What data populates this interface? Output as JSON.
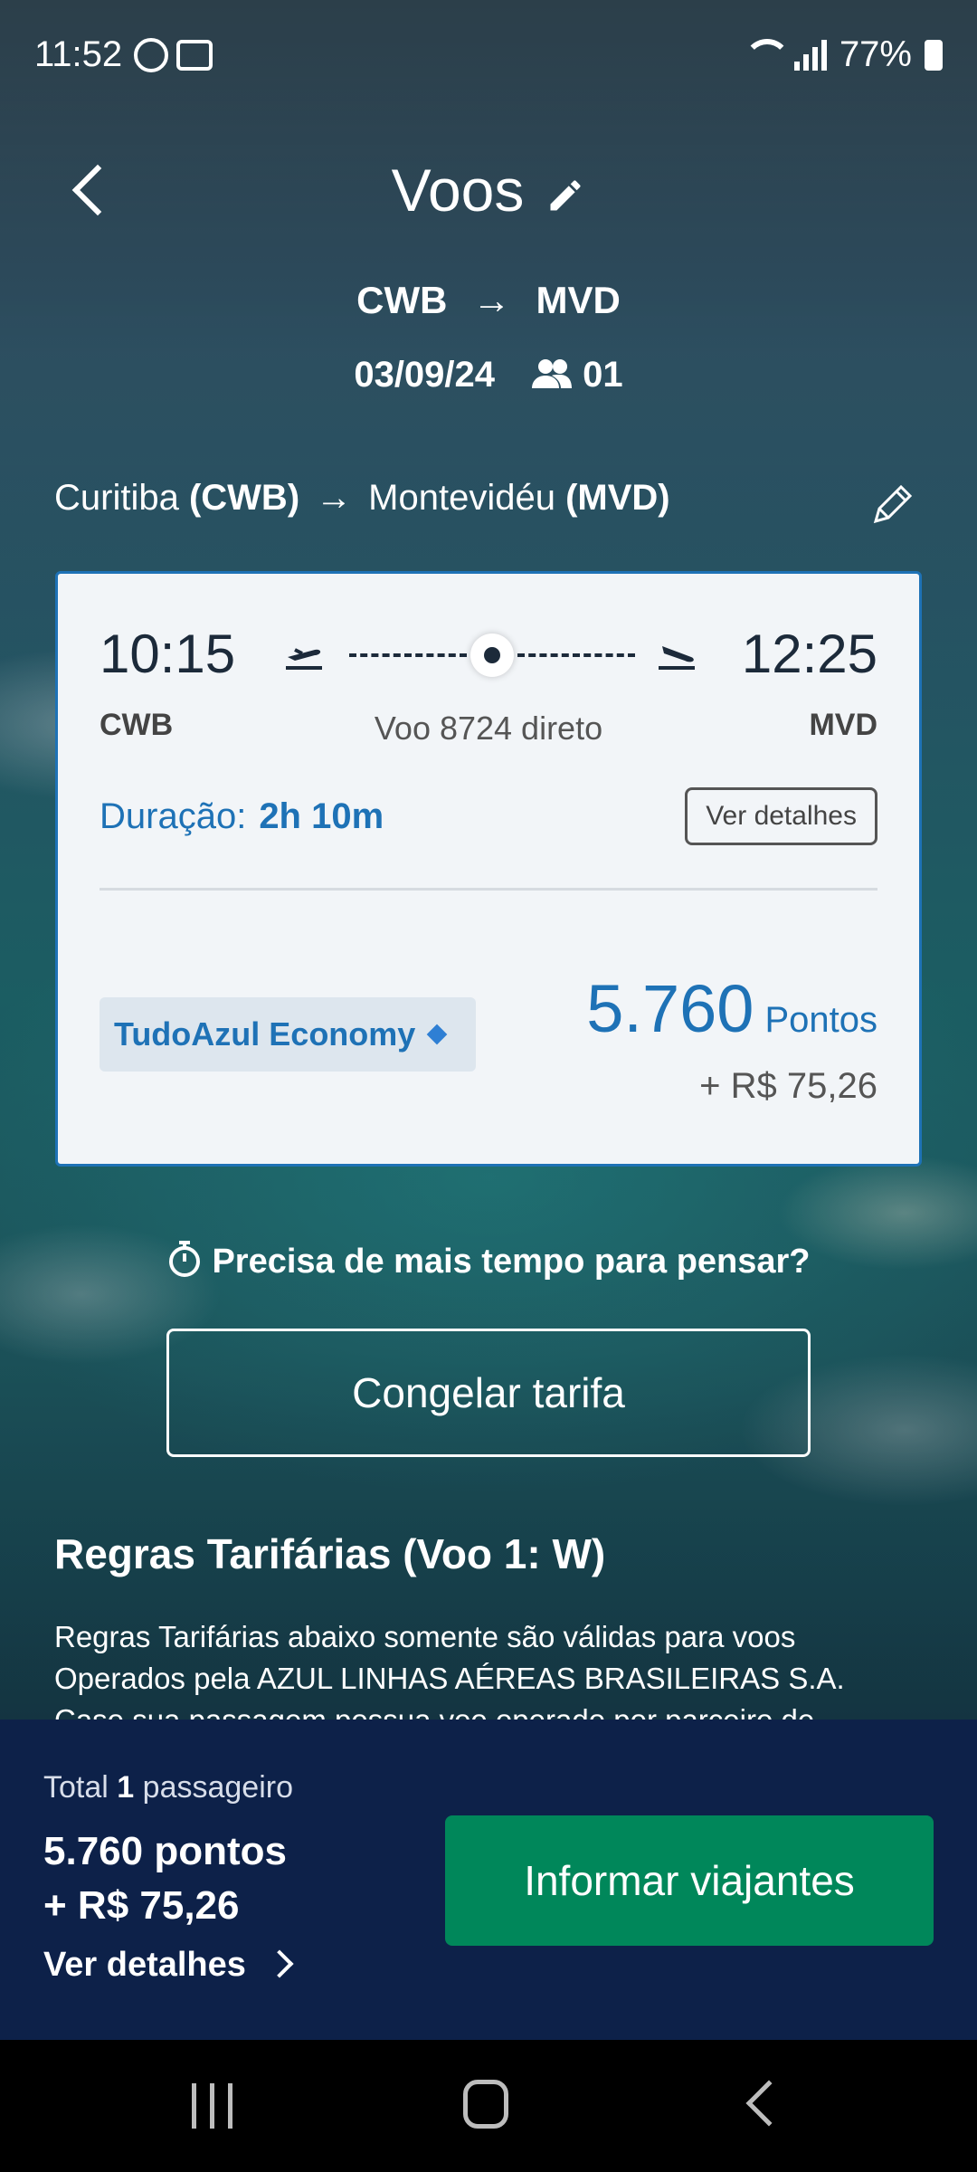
{
  "status_bar": {
    "time": "11:52",
    "battery": "77%"
  },
  "header": {
    "title": "Voos",
    "origin_code": "CWB",
    "destination_code": "MVD",
    "arrow": "→",
    "date": "03/09/24",
    "passengers": "01"
  },
  "route": {
    "origin_city": "Curitiba",
    "origin_code": "(CWB)",
    "arrow": "→",
    "destination_city": "Montevidéu",
    "destination_code": "(MVD)"
  },
  "flight_card": {
    "departure_time": "10:15",
    "arrival_time": "12:25",
    "departure_code": "CWB",
    "arrival_code": "MVD",
    "flight_info": "Voo 8724 direto",
    "duration_label": "Duração:",
    "duration_value": "2h 10m",
    "details_button": "Ver detalhes",
    "fare_family": "TudoAzul Economy",
    "points_value": "5.760",
    "points_label": "Pontos",
    "money": "+ R$ 75,26"
  },
  "freeze": {
    "question": "Precisa de mais tempo para pensar?",
    "button": "Congelar tarifa"
  },
  "rules": {
    "title": "Regras Tarifárias (Voo 1: W)",
    "line1": "Regras Tarifárias abaixo somente são válidas para voos",
    "line2": "Operados pela AZUL LINHAS AÉREAS BRASILEIRAS S.A.",
    "line3": "Caso sua passagem possua voo operado por parceiro de"
  },
  "bottom_bar": {
    "total_prefix": "Total",
    "total_count": "1",
    "total_suffix": "passageiro",
    "points": "5.760 pontos",
    "money": "+ R$ 75,26",
    "details_link": "Ver detalhes",
    "cta": "Informar viajantes"
  },
  "colors": {
    "accent_blue": "#1e72b6",
    "panel_navy": "#0d2149",
    "cta_green": "#00875a"
  }
}
